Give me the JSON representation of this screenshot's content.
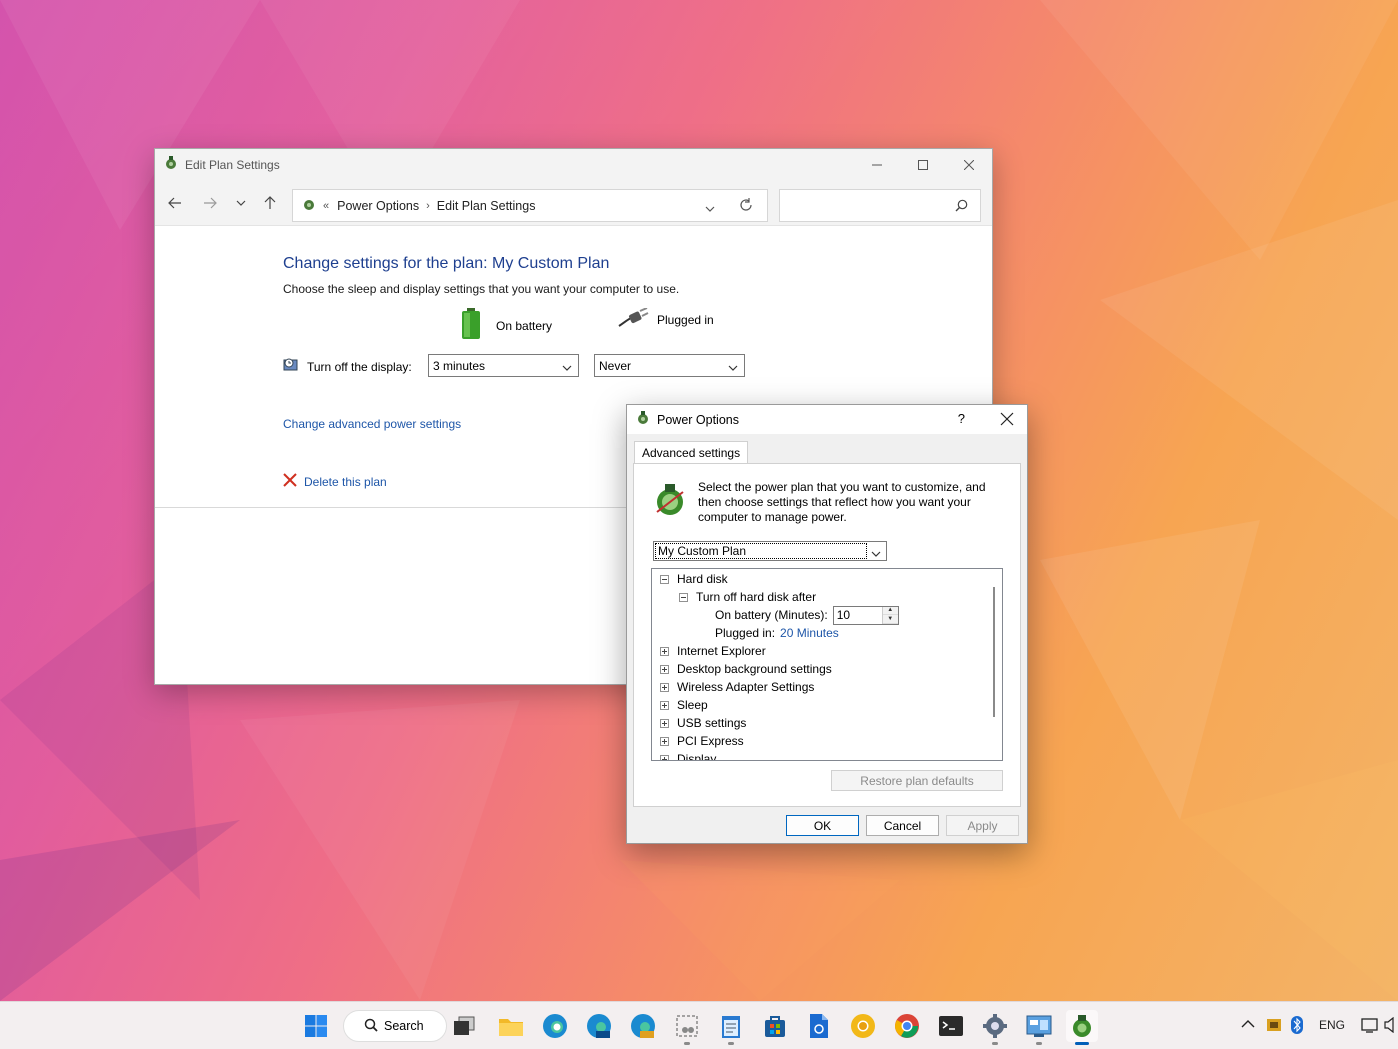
{
  "main_window": {
    "title": "Edit Plan Settings",
    "breadcrumb": [
      "Power Options",
      "Edit Plan Settings"
    ],
    "heading": "Change settings for the plan: My Custom Plan",
    "subtext": "Choose the sleep and display settings that you want your computer to use.",
    "on_battery_label": "On battery",
    "plugged_in_label": "Plugged in",
    "display_label": "Turn off the display:",
    "display_battery_value": "3 minutes",
    "display_plugged_value": "Never",
    "advanced_link": "Change advanced power settings",
    "delete_link": "Delete this plan"
  },
  "dialog": {
    "title": "Power Options",
    "help": "?",
    "tab": "Advanced settings",
    "intro": "Select the power plan that you want to customize, and then choose settings that reflect how you want your computer to manage power.",
    "plan_value": "My Custom Plan",
    "tree": {
      "hard_disk": "Hard disk",
      "turn_off_after": "Turn off hard disk after",
      "on_battery_label": "On battery (Minutes):",
      "on_battery_value": "10",
      "plugged_in_label": "Plugged in:",
      "plugged_in_value": "20 Minutes",
      "collapsed": [
        "Internet Explorer",
        "Desktop background settings",
        "Wireless Adapter Settings",
        "Sleep",
        "USB settings",
        "PCI Express",
        "Display"
      ]
    },
    "restore_button": "Restore plan defaults",
    "ok_button": "OK",
    "cancel_button": "Cancel",
    "apply_button": "Apply"
  },
  "taskbar": {
    "search_label": "Search",
    "language": "ENG"
  },
  "colors": {
    "heading": "#1e3f8f",
    "link": "#1e56a8",
    "accent": "#0067c0"
  }
}
